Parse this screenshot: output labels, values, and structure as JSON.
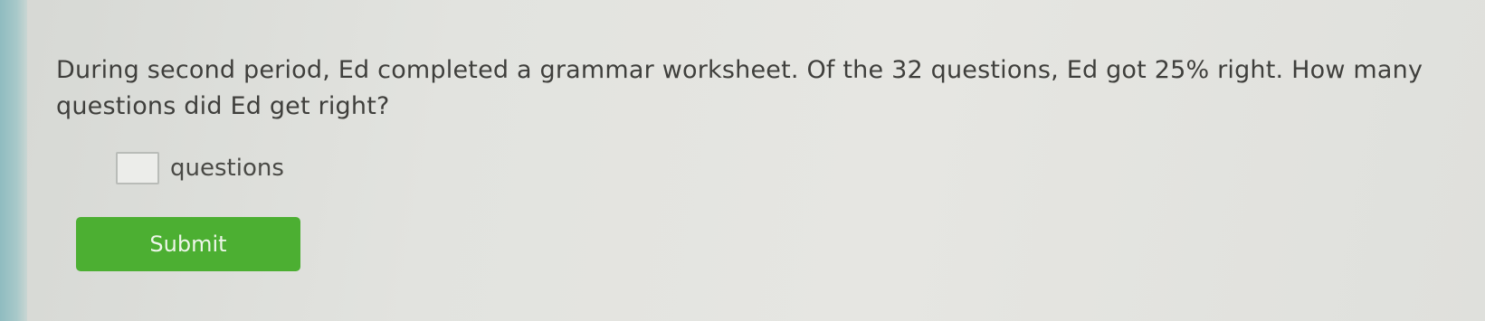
{
  "question": {
    "text": "During second period, Ed completed a grammar worksheet. Of the 32 questions, Ed got 25% right. How many questions did Ed get right?"
  },
  "answer": {
    "value": "",
    "unit_label": "questions"
  },
  "submit": {
    "label": "Submit"
  }
}
